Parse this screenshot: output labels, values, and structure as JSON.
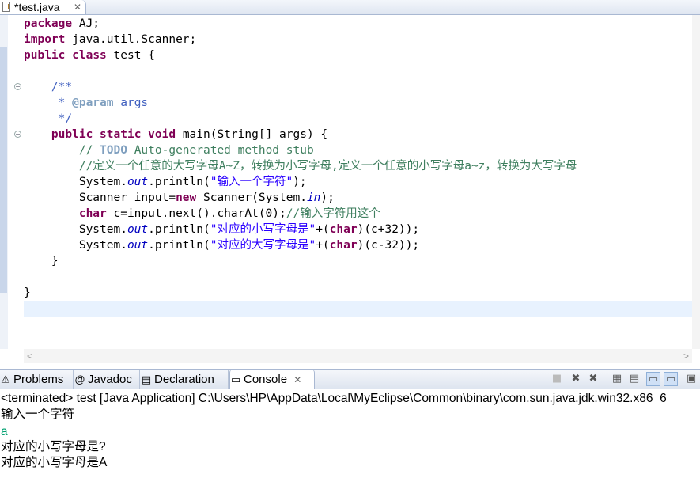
{
  "editor_tab": {
    "label": "*test.java",
    "close": "✕",
    "icon": "java-file-icon"
  },
  "code": {
    "lines": [
      [
        {
          "t": "package",
          "c": "kw"
        },
        {
          "t": " AJ;"
        }
      ],
      [
        {
          "t": "import",
          "c": "kw"
        },
        {
          "t": " java.util.Scanner;"
        }
      ],
      [
        {
          "t": "public",
          "c": "kw"
        },
        {
          "t": " "
        },
        {
          "t": "class",
          "c": "kw"
        },
        {
          "t": " test {"
        }
      ],
      [
        {
          "t": ""
        }
      ],
      [
        {
          "t": "    "
        },
        {
          "t": "/**",
          "c": "jd"
        }
      ],
      [
        {
          "t": "     * ",
          "c": "jd"
        },
        {
          "t": "@param",
          "c": "jtag"
        },
        {
          "t": " args",
          "c": "jd"
        }
      ],
      [
        {
          "t": "     */",
          "c": "jd"
        }
      ],
      [
        {
          "t": "    "
        },
        {
          "t": "public",
          "c": "kw"
        },
        {
          "t": " "
        },
        {
          "t": "static",
          "c": "kw"
        },
        {
          "t": " "
        },
        {
          "t": "void",
          "c": "kw"
        },
        {
          "t": " main(String[] args) {"
        }
      ],
      [
        {
          "t": "        "
        },
        {
          "t": "// ",
          "c": "cm"
        },
        {
          "t": "TODO",
          "c": "jtag"
        },
        {
          "t": " Auto-generated method stub",
          "c": "cm"
        }
      ],
      [
        {
          "t": "        "
        },
        {
          "t": "//定义一个任意的大写字母A~Z，转换为小写字母,定义一个任意的小写字母a~z，转换为大写字母",
          "c": "cm"
        }
      ],
      [
        {
          "t": "        System."
        },
        {
          "t": "out",
          "c": "fld"
        },
        {
          "t": ".println("
        },
        {
          "t": "\"输入一个字符\"",
          "c": "str"
        },
        {
          "t": ");"
        }
      ],
      [
        {
          "t": "        Scanner input="
        },
        {
          "t": "new",
          "c": "kw"
        },
        {
          "t": " Scanner(System."
        },
        {
          "t": "in",
          "c": "fld"
        },
        {
          "t": ");"
        }
      ],
      [
        {
          "t": "        "
        },
        {
          "t": "char",
          "c": "kw"
        },
        {
          "t": " c=input.next().charAt(0);"
        },
        {
          "t": "//输入字符用这个",
          "c": "cm"
        }
      ],
      [
        {
          "t": "        System."
        },
        {
          "t": "out",
          "c": "fld"
        },
        {
          "t": ".println("
        },
        {
          "t": "\"对应的小写字母是\"",
          "c": "str"
        },
        {
          "t": "+("
        },
        {
          "t": "char",
          "c": "kw"
        },
        {
          "t": ")(c+32));"
        }
      ],
      [
        {
          "t": "        System."
        },
        {
          "t": "out",
          "c": "fld"
        },
        {
          "t": ".println("
        },
        {
          "t": "\"对应的大写字母是\"",
          "c": "str"
        },
        {
          "t": "+("
        },
        {
          "t": "char",
          "c": "kw"
        },
        {
          "t": ")(c-32));"
        }
      ],
      [
        {
          "t": "    }"
        }
      ],
      [
        {
          "t": ""
        }
      ],
      [
        {
          "t": "}"
        }
      ],
      [
        {
          "t": ""
        }
      ]
    ]
  },
  "views": {
    "tabs": [
      {
        "label": "Problems",
        "icon": "problems-icon",
        "glyph": "⚠"
      },
      {
        "label": "Javadoc",
        "icon": "javadoc-icon",
        "glyph": "@"
      },
      {
        "label": "Declaration",
        "icon": "declaration-icon",
        "glyph": "▤"
      },
      {
        "label": "Console",
        "icon": "console-icon",
        "glyph": "▭",
        "close": "✕"
      }
    ]
  },
  "console": {
    "header": "<terminated> test [Java Application] C:\\Users\\HP\\AppData\\Local\\MyEclipse\\Common\\binary\\com.sun.java.jdk.win32.x86_6",
    "lines": [
      {
        "text": "输入一个字符",
        "type": "out"
      },
      {
        "text": "a",
        "type": "in"
      },
      {
        "text": "对应的小写字母是?",
        "type": "out"
      },
      {
        "text": "对应的小写字母是A",
        "type": "out"
      }
    ]
  },
  "colors": {
    "keyword": "#7f0055",
    "comment": "#3f7f5f",
    "javadoc": "#3f5fbf",
    "string": "#2a00ff",
    "field": "#0000c0",
    "console_input": "#00a070"
  }
}
